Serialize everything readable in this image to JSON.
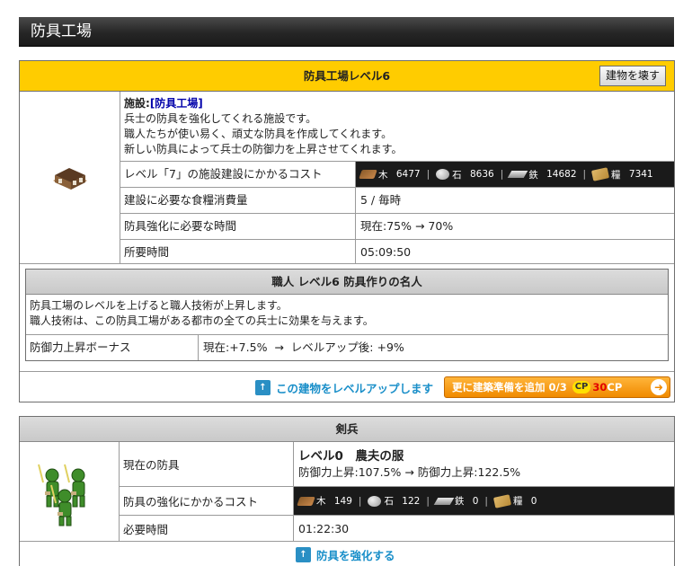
{
  "page_title": "防具工場",
  "facility": {
    "header": "防具工場レベル6",
    "destroy_button": "建物を壊す",
    "desc_prefix": "施設:",
    "desc_link": "[防具工場]",
    "desc_lines": [
      "兵士の防具を強化してくれる施設です。",
      "職人たちが使い易く、頑丈な防具を作成してくれます。",
      "新しい防具によって兵士の防御力を上昇させてくれます。"
    ],
    "cost_label": "レベル「7」の施設建設にかかるコスト",
    "costs": [
      {
        "name": "木",
        "value": "6477",
        "icon": "wood-icon"
      },
      {
        "name": "石",
        "value": "8636",
        "icon": "stone-icon"
      },
      {
        "name": "鉄",
        "value": "14682",
        "icon": "iron-icon"
      },
      {
        "name": "糧",
        "value": "7341",
        "icon": "grain-icon"
      }
    ],
    "food_label": "建設に必要な食糧消費量",
    "food_value": "5 / 毎時",
    "time_label": "防具強化に必要な時間",
    "time_value": "現在:75% → 70%",
    "duration_label": "所要時間",
    "duration_value": "05:09:50"
  },
  "craftsman": {
    "header": "職人 レベル6 防具作りの名人",
    "text_lines": [
      "防具工場のレベルを上げると職人技術が上昇します。",
      "職人技術は、この防具工場がある都市の全ての兵士に効果を与えます。"
    ],
    "bonus_label": "防御力上昇ボーナス",
    "bonus_value": "現在:+7.5%  →  レベルアップ後: +9%"
  },
  "levelup_link": "この建物をレベルアップします",
  "prep_button": {
    "text": "更に建築準備を追加 0/3",
    "cp_badge": "CP",
    "cp_amount": "30",
    "cp_unit": "CP"
  },
  "unit": {
    "header": "剣兵",
    "armor_label": "現在の防具",
    "armor_name": "レベル0　農夫の服",
    "armor_stats": "防御力上昇:107.5% → 防御力上昇:122.5%",
    "cost_label": "防具の強化にかかるコスト",
    "costs": [
      {
        "name": "木",
        "value": "149",
        "icon": "wood-icon"
      },
      {
        "name": "石",
        "value": "122",
        "icon": "stone-icon"
      },
      {
        "name": "鉄",
        "value": "0",
        "icon": "iron-icon"
      },
      {
        "name": "糧",
        "value": "0",
        "icon": "grain-icon"
      }
    ],
    "time_label": "必要時間",
    "time_value": "01:22:30",
    "enhance_link": "防具を強化する"
  }
}
